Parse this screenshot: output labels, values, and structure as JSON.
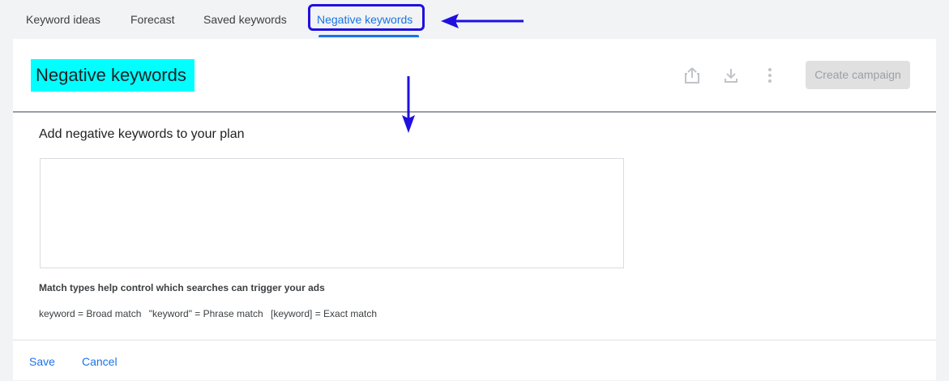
{
  "tabs": [
    {
      "label": "Keyword ideas"
    },
    {
      "label": "Forecast"
    },
    {
      "label": "Saved keywords"
    },
    {
      "label": "Negative keywords",
      "active": true
    }
  ],
  "header": {
    "title": "Negative keywords",
    "title_highlight_color": "#00ffff",
    "icons": [
      "share-icon",
      "download-icon",
      "more-vert-icon"
    ],
    "create_campaign_label": "Create campaign"
  },
  "main": {
    "section_title": "Add negative keywords to your plan",
    "textarea_value": "",
    "match_types_title": "Match types help control which searches can trigger your ads",
    "match_types": [
      "keyword = Broad match",
      "\"keyword\" = Phrase match",
      "[keyword] = Exact match"
    ]
  },
  "footer": {
    "save_label": "Save",
    "cancel_label": "Cancel"
  },
  "annotations": {
    "arrow_color": "#1f10e0",
    "highlight_color": "#00ffff",
    "accent_color": "#1a73e8"
  }
}
